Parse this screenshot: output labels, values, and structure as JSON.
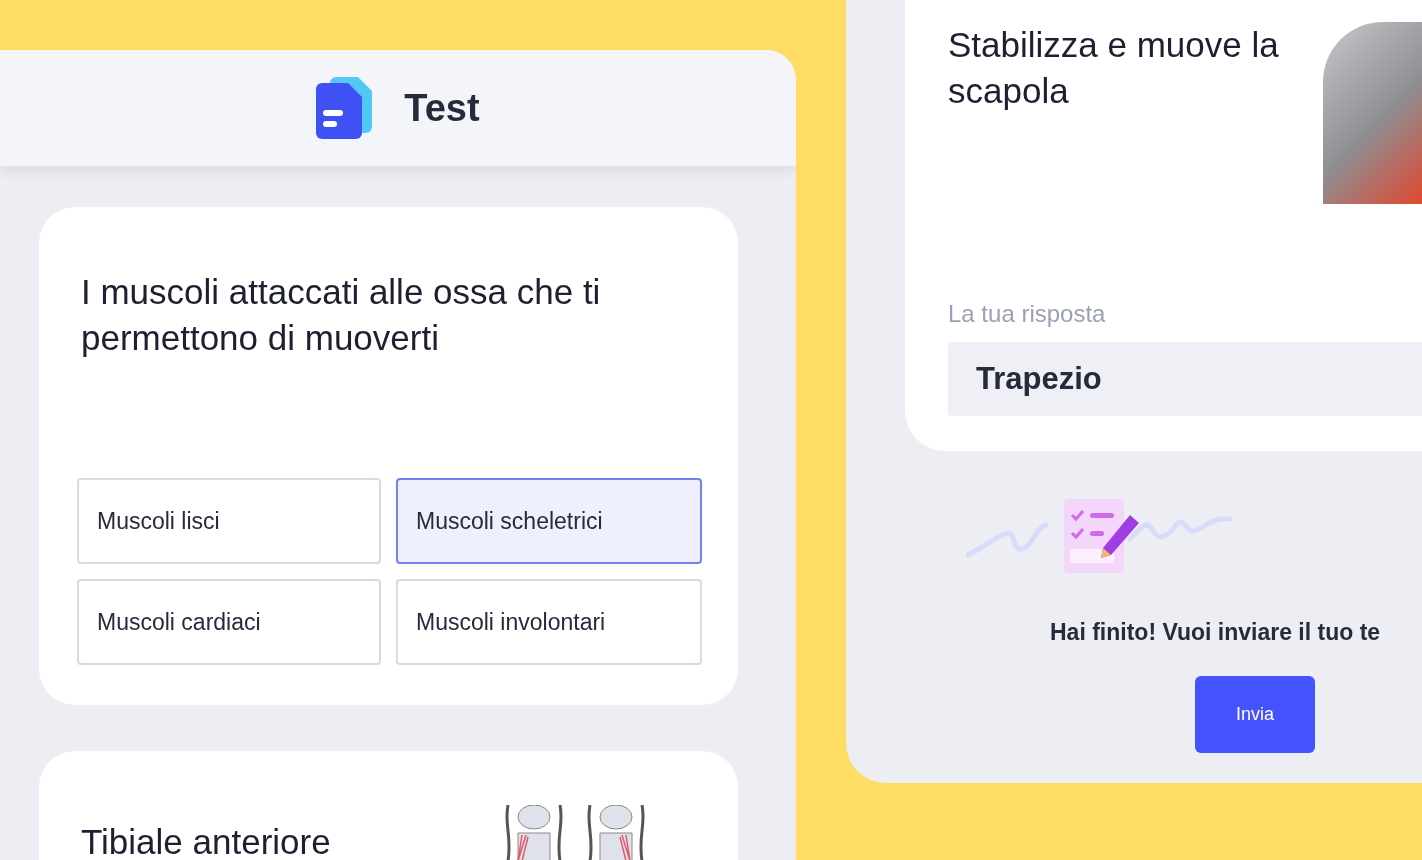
{
  "test_screen": {
    "header": {
      "title": "Test"
    },
    "questions": [
      {
        "kind": "choice",
        "prompt": "I muscoli attaccati alle ossa che ti permettono di muoverti",
        "options": [
          {
            "label": "Muscoli lisci",
            "selected": false
          },
          {
            "label": "Muscoli scheletrici",
            "selected": true
          },
          {
            "label": "Muscoli cardiaci",
            "selected": false
          },
          {
            "label": "Muscoli involontari",
            "selected": false
          }
        ]
      },
      {
        "kind": "image",
        "prompt": "Tibiale anteriore"
      }
    ]
  },
  "answer_screen": {
    "prompt": "Stabilizza e muove la scapola",
    "answer_label": "La tua risposta",
    "answer_value": "Trapezio",
    "finish_message": "Hai finito! Vuoi inviare il tuo te",
    "submit_button": "Invia"
  }
}
